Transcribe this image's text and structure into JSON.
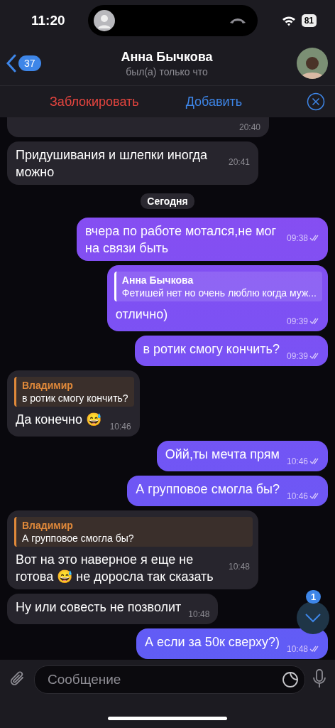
{
  "status_bar": {
    "time": "11:20",
    "battery": "81"
  },
  "header": {
    "back_count": "37",
    "name": "Анна Бычкова",
    "status": "был(а) только что"
  },
  "action_bar": {
    "block": "Заблокировать",
    "add": "Добавить"
  },
  "messages": [
    {
      "kind": "incoming",
      "time": "20:40",
      "cut": true
    },
    {
      "kind": "incoming",
      "text": "Придушивания и шлепки иногда можно",
      "time": "20:41"
    },
    {
      "kind": "date",
      "text": "Сегодня"
    },
    {
      "kind": "outgoing",
      "text": "вчера по работе мотался,не мог на связи быть",
      "time": "09:38",
      "read": true
    },
    {
      "kind": "outgoing",
      "reply": {
        "name": "Анна Бычкова",
        "text": "Фетишей нет но очень люблю когда муж..."
      },
      "text": "отлично)",
      "time": "09:39",
      "read": true
    },
    {
      "kind": "outgoing",
      "text": "в ротик смогу кончить?",
      "time": "09:39",
      "read": true
    },
    {
      "kind": "incoming",
      "reply": {
        "name": "Владимир",
        "text": "в ротик смогу кончить?"
      },
      "text": "Да конечно 😅",
      "time": "10:46"
    },
    {
      "kind": "outgoing",
      "text": "Ойй,ты мечта прям",
      "time": "10:46",
      "read": true
    },
    {
      "kind": "outgoing",
      "text": "А групповое смогла бы?",
      "time": "10:46",
      "read": true
    },
    {
      "kind": "incoming",
      "reply": {
        "name": "Владимир",
        "text": "А групповое смогла бы?"
      },
      "text": "Вот на это наверное я еще не готова 😅 не доросла так сказать",
      "time": "10:48"
    },
    {
      "kind": "incoming",
      "text": "Ну или совесть не позволит",
      "time": "10:48"
    },
    {
      "kind": "outgoing",
      "text": "А если за 50к сверху?)",
      "time": "10:48",
      "read": true
    }
  ],
  "scroll_badge": "1",
  "composer": {
    "placeholder": "Сообщение"
  }
}
